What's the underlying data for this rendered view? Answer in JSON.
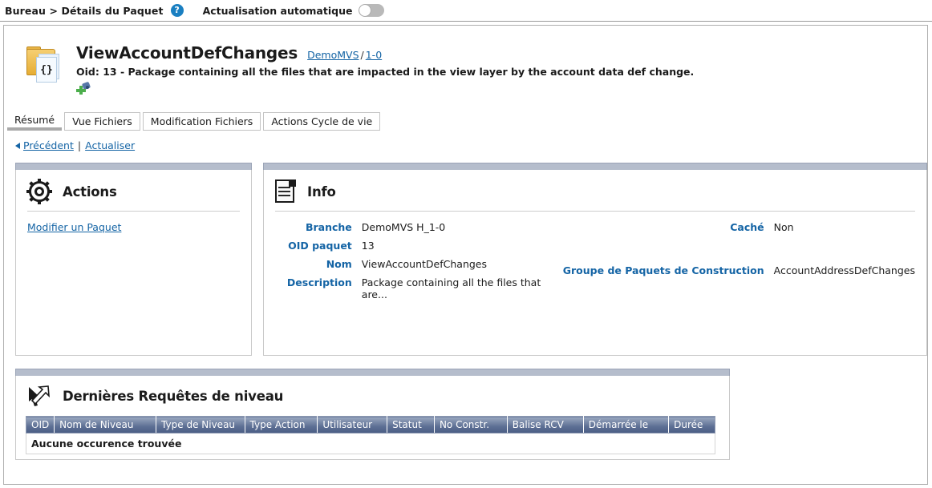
{
  "topbar": {
    "breadcrumb": "Bureau > Détails du Paquet",
    "help_icon": "help-icon",
    "autorefresh_label": "Actualisation automatique",
    "toggle_state": "off"
  },
  "object_header": {
    "icon": "package-folder-icon",
    "title": "ViewAccountDefChanges",
    "branch_link": "DemoMVS",
    "separator": "/",
    "version_link": "1-0",
    "description": "Oid: 13 - Package containing all the files that are impacted in the view layer by the account data def change.",
    "add_icon": "add-node-icon",
    "doc_glyph": "{}"
  },
  "tabs": [
    {
      "label": "Résumé",
      "active": true
    },
    {
      "label": "Vue Fichiers",
      "active": false
    },
    {
      "label": "Modification Fichiers",
      "active": false
    },
    {
      "label": "Actions Cycle de vie",
      "active": false
    }
  ],
  "navlinks": {
    "back": "Précédent",
    "separator": "|",
    "refresh": "Actualiser"
  },
  "actions_panel": {
    "icon": "gear-icon",
    "title": "Actions",
    "links": [
      {
        "label": "Modifier un Paquet"
      }
    ]
  },
  "info_panel": {
    "icon": "document-icon",
    "title": "Info",
    "left_fields": [
      {
        "label": "Branche",
        "value": "DemoMVS H_1-0"
      },
      {
        "label": "OID paquet",
        "value": "13"
      },
      {
        "label": "Nom",
        "value": "ViewAccountDefChanges"
      },
      {
        "label": "Description",
        "value": "Package containing all the files that are..."
      }
    ],
    "right_fields": [
      {
        "label": "Caché",
        "value": "Non"
      },
      {
        "label": "Groupe de Paquets de Construction",
        "value": "AccountAddressDefChanges"
      }
    ]
  },
  "requests_panel": {
    "icon": "cursor-arrow-icon",
    "title": "Dernières Requêtes de niveau",
    "columns": [
      "OID",
      "Nom de Niveau",
      "Type de Niveau",
      "Type Action",
      "Utilisateur",
      "Statut",
      "No Constr.",
      "Balise RCV",
      "Démarrée le",
      "Durée"
    ],
    "rows": [],
    "empty_message": "Aucune occurence trouvée"
  },
  "colors": {
    "link": "#1464a5",
    "label": "#1464a5",
    "panel_bar": "#b5bdcc",
    "table_header_top": "#9aa8c0",
    "table_header_bottom": "#4a5d84",
    "help_icon_bg": "#1a7fc1",
    "folder": "#e8b445",
    "add_green": "#4cae4c"
  }
}
